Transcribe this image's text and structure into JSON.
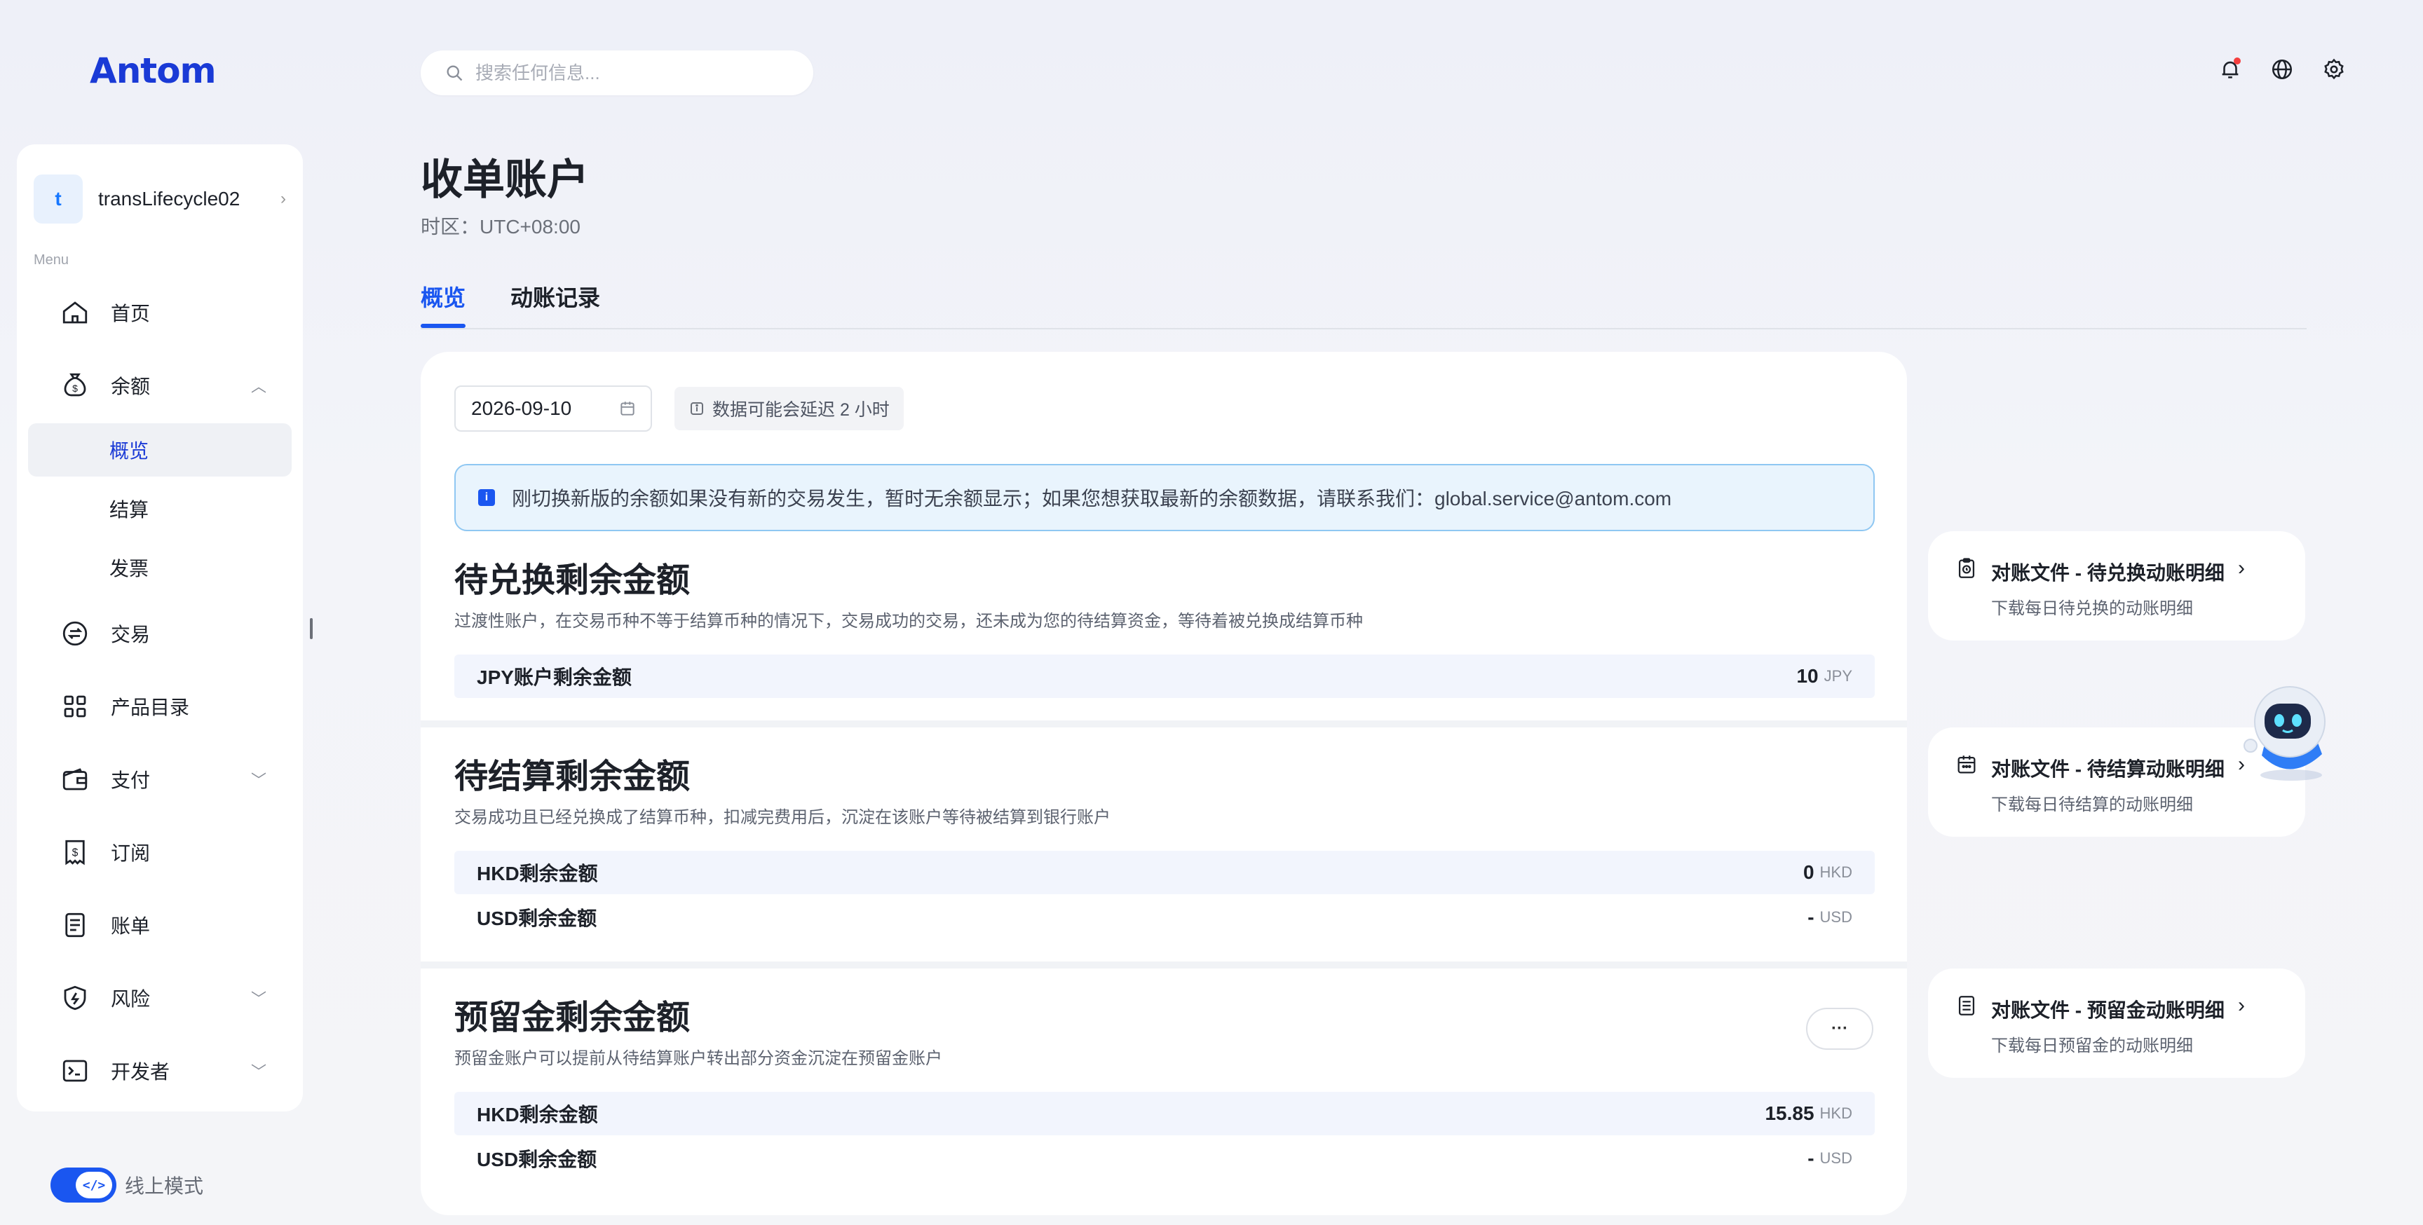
{
  "app": {
    "logo": "Antom"
  },
  "header": {
    "search_placeholder": "搜索任何信息...",
    "icons": [
      "bell-icon",
      "globe-icon",
      "gear-icon"
    ]
  },
  "sidebar": {
    "account_initial": "t",
    "account_name": "transLifecycle02",
    "menu_caption": "Menu",
    "items": [
      {
        "label": "首页",
        "icon": "home-icon"
      },
      {
        "label": "余额",
        "icon": "money-bag-icon",
        "expanded": true,
        "children": [
          {
            "label": "概览",
            "active": true
          },
          {
            "label": "结算"
          },
          {
            "label": "发票"
          }
        ]
      },
      {
        "label": "交易",
        "icon": "exchange-icon"
      },
      {
        "label": "产品目录",
        "icon": "grid-icon"
      },
      {
        "label": "支付",
        "icon": "wallet-icon"
      },
      {
        "label": "订阅",
        "icon": "subscription-icon"
      },
      {
        "label": "账单",
        "icon": "bill-icon"
      },
      {
        "label": "风险",
        "icon": "shield-icon"
      },
      {
        "label": "开发者",
        "icon": "terminal-icon"
      }
    ],
    "mode_label": "线上模式",
    "toggle_glyph": "</>"
  },
  "page": {
    "title": "收单账户",
    "timezone": "时区：UTC+08:00",
    "tabs": [
      {
        "label": "概览",
        "active": true
      },
      {
        "label": "动账记录"
      }
    ]
  },
  "main": {
    "date": "2026-09-10",
    "delay_note": "数据可能会延迟 2 小时",
    "notice": "刚切换新版的余额如果没有新的交易发生，暂时无余额显示；如果您想获取最新的余额数据，请联系我们：global.service@antom.com",
    "sections": [
      {
        "title": "待兑换剩余金额",
        "desc": "过渡性账户，在交易币种不等于结算币种的情况下，交易成功的交易，还未成为您的待结算资金，等待着被兑换成结算币种",
        "rows": [
          {
            "label": "JPY账户剩余金额",
            "value": "10",
            "currency": "JPY"
          }
        ]
      },
      {
        "title": "待结算剩余金额",
        "desc": "交易成功且已经兑换成了结算币种，扣减完费用后，沉淀在该账户等待被结算到银行账户",
        "rows": [
          {
            "label": "HKD剩余金额",
            "value": "0",
            "currency": "HKD"
          },
          {
            "label": "USD剩余金额",
            "value": "-",
            "currency": "USD"
          }
        ]
      },
      {
        "title": "预留金剩余金额",
        "desc": "预留金账户可以提前从待结算账户转出部分资金沉淀在预留金账户",
        "more_label": "···",
        "rows": [
          {
            "label": "HKD剩余金额",
            "value": "15.85",
            "currency": "HKD"
          },
          {
            "label": "USD剩余金额",
            "value": "-",
            "currency": "USD"
          }
        ]
      }
    ]
  },
  "right_cards": [
    {
      "title": "对账文件 - 待兑换动账明细",
      "subtitle": "下载每日待兑换的动账明细",
      "icon": "clipboard-clock-icon"
    },
    {
      "title": "对账文件 - 待结算动账明细",
      "subtitle": "下载每日待结算的动账明细",
      "icon": "calendar-icon"
    },
    {
      "title": "对账文件 - 预留金动账明细",
      "subtitle": "下载每日预留金的动账明细",
      "icon": "document-icon"
    }
  ],
  "colors": {
    "accent": "#1a56f0",
    "brand": "#1a3ad6",
    "notice_bg": "#e9f4fd",
    "row_bg": "#f2f5fd"
  }
}
